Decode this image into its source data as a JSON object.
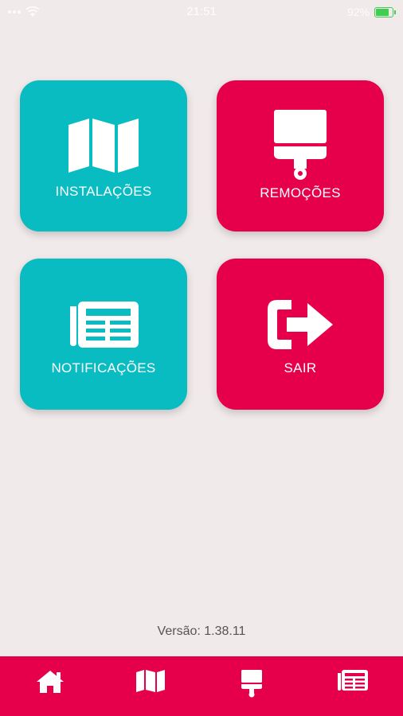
{
  "status_bar": {
    "time": "21:51",
    "battery_text": "92%"
  },
  "tiles": [
    {
      "label": "INSTALAÇÕES",
      "icon": "map-icon",
      "color": "#08bcc2"
    },
    {
      "label": "REMOÇÕES",
      "icon": "paint-brush-icon",
      "color": "#e6004c"
    },
    {
      "label": "NOTIFICAÇÕES",
      "icon": "newspaper-icon",
      "color": "#08bcc2"
    },
    {
      "label": "SAIR",
      "icon": "logout-icon",
      "color": "#e6004c"
    }
  ],
  "version_text": "Versão: 1.38.11",
  "tab_bar": {
    "color": "#e6004c",
    "items": [
      "home-icon",
      "map-icon",
      "paint-brush-icon",
      "newspaper-icon"
    ]
  }
}
